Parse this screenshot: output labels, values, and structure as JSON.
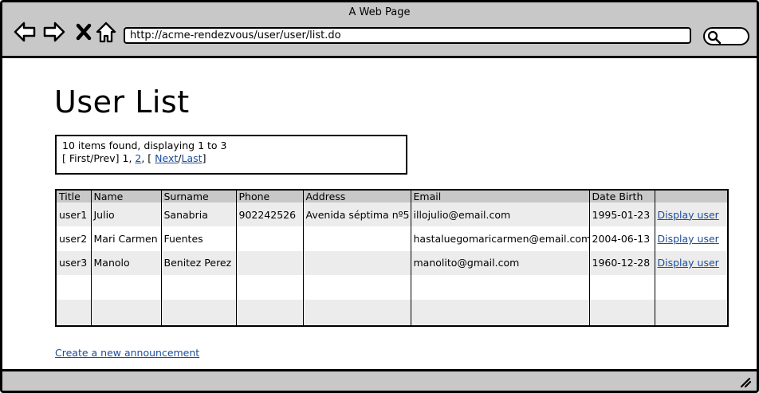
{
  "window": {
    "title": "A Web Page"
  },
  "browser": {
    "url": "http://acme-rendezvous/user/user/list.do",
    "icons": [
      "back-arrow-icon",
      "forward-arrow-icon",
      "close-x-icon",
      "home-icon",
      "search-icon"
    ]
  },
  "page": {
    "title": "User List",
    "pager": {
      "summary": "10 items found, displaying 1 to 3",
      "prefix": "[ First/Prev] 1,",
      "page2": "2",
      "sep": ", [",
      "next": "Next",
      "slash": "/",
      "last": "Last",
      "suffix": "]"
    },
    "table": {
      "headers": [
        "Title",
        "Name",
        "Surname",
        "Phone",
        "Address",
        "Email",
        "Date Birth",
        ""
      ],
      "rows": [
        [
          "user1",
          "Julio",
          "Sanabria",
          "902242526",
          "Avenida séptima nº5",
          "illojulio@email.com",
          "1995-01-23",
          "Display user"
        ],
        [
          "user2",
          "Mari Carmen",
          "Fuentes",
          "",
          "",
          "hastaluegomaricarmen@email.com",
          "2004-06-13",
          "Display user"
        ],
        [
          "user3",
          "Manolo",
          "Benitez Perez",
          "",
          "",
          "manolito@gmail.com",
          "1960-12-28",
          "Display user"
        ]
      ]
    },
    "create_link": "Create a new announcement"
  },
  "colors": {
    "chrome": "#c8c8c8",
    "link": "#1a4d9b",
    "row_alt": "#ececec"
  }
}
